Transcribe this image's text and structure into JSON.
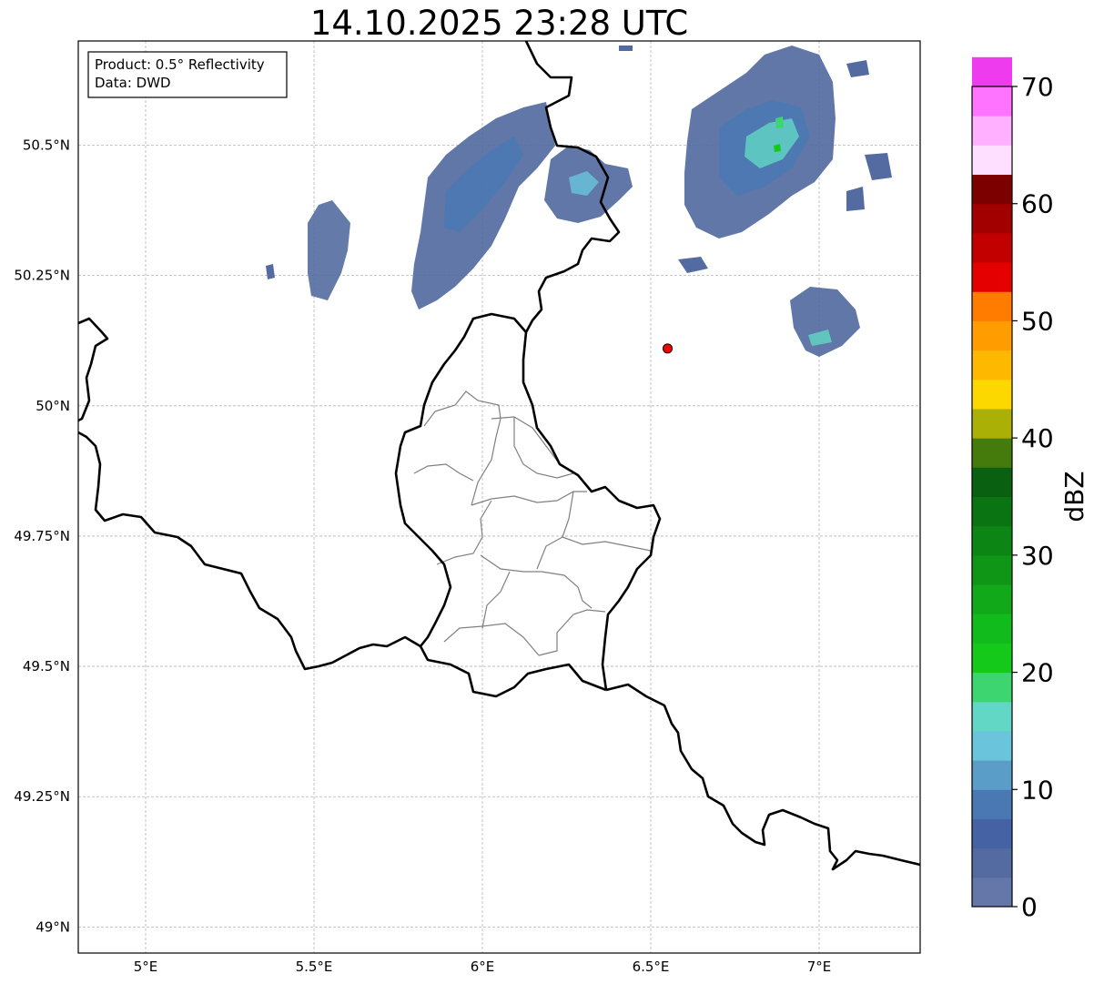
{
  "title": "14.10.2025 23:28 UTC",
  "info_box": {
    "line1": "Product: 0.5° Reflectivity",
    "line2": "Data: DWD"
  },
  "map": {
    "lon_range": [
      4.8,
      7.3
    ],
    "lat_range": [
      48.95,
      50.7
    ],
    "lon_ticks": [
      {
        "value": 5.0,
        "label": "5°E"
      },
      {
        "value": 5.5,
        "label": "5.5°E"
      },
      {
        "value": 6.0,
        "label": "6°E"
      },
      {
        "value": 6.5,
        "label": "6.5°E"
      },
      {
        "value": 7.0,
        "label": "7°E"
      }
    ],
    "lat_ticks": [
      {
        "value": 49.0,
        "label": "49°N"
      },
      {
        "value": 49.25,
        "label": "49.25°N"
      },
      {
        "value": 49.5,
        "label": "49.5°N"
      },
      {
        "value": 49.75,
        "label": "49.75°N"
      },
      {
        "value": 50.0,
        "label": "50°N"
      },
      {
        "value": 50.25,
        "label": "50.25°N"
      },
      {
        "value": 50.5,
        "label": "50.5°N"
      }
    ],
    "radar_site": {
      "lon": 6.55,
      "lat": 50.11,
      "color": "#ff0000"
    },
    "grid": true
  },
  "colorbar": {
    "label": "dBZ",
    "min": 0,
    "max": 70,
    "step": 2.5,
    "ticks": [
      {
        "value": 0,
        "label": "0"
      },
      {
        "value": 10,
        "label": "10"
      },
      {
        "value": 20,
        "label": "20"
      },
      {
        "value": 30,
        "label": "30"
      },
      {
        "value": 40,
        "label": "40"
      },
      {
        "value": 50,
        "label": "50"
      },
      {
        "value": 60,
        "label": "60"
      },
      {
        "value": 70,
        "label": "70"
      }
    ],
    "colors": [
      "#6577a8",
      "#536ba0",
      "#4562a4",
      "#4a78b3",
      "#5a9dc9",
      "#6ac4dc",
      "#63d7c5",
      "#3dd570",
      "#14c91a",
      "#12bb1c",
      "#11a81a",
      "#0f9617",
      "#0d8515",
      "#0a7312",
      "#086010",
      "#457a0c",
      "#aab006",
      "#fdd700",
      "#ffb800",
      "#ff9d00",
      "#ff7c00",
      "#e50000",
      "#c20000",
      "#a20000",
      "#7c0000",
      "#ffdfff",
      "#ffb1ff",
      "#ff74ff",
      "#ee3bee"
    ]
  }
}
